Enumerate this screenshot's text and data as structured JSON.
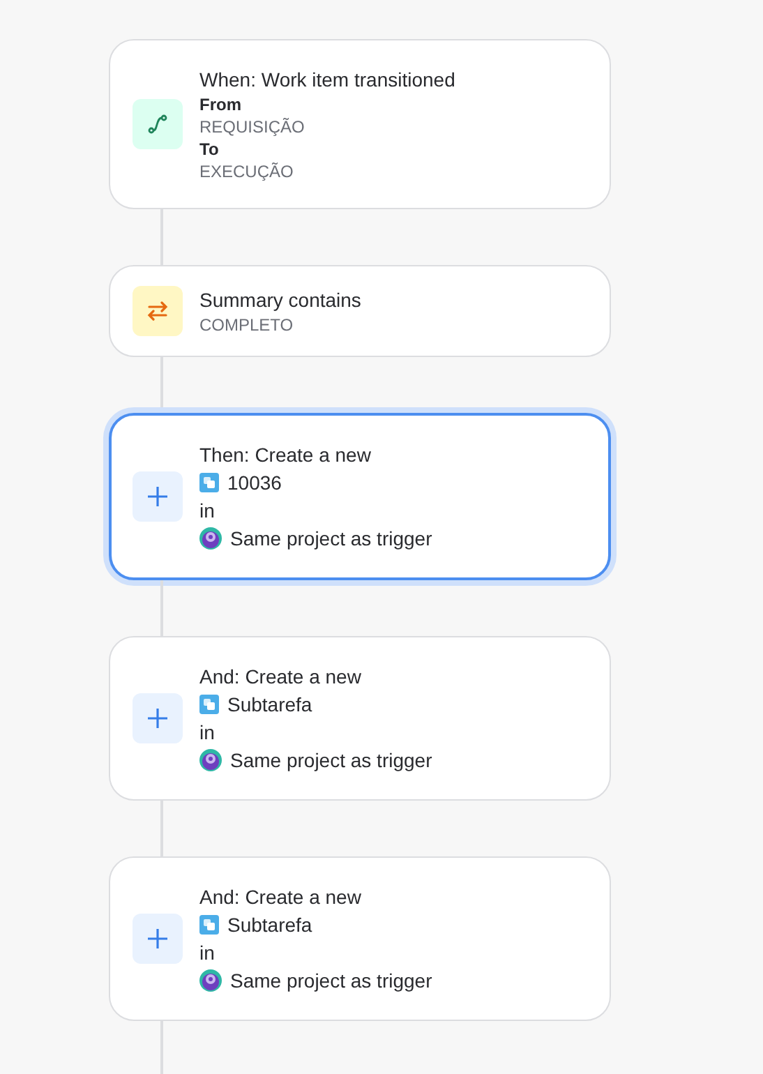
{
  "steps": [
    {
      "kind": "trigger",
      "selected": false,
      "title": "When: Work item transitioned",
      "details": [
        {
          "kind": "label",
          "text": "From"
        },
        {
          "kind": "value",
          "text": "REQUISIÇÃO"
        },
        {
          "kind": "label",
          "text": "To"
        },
        {
          "kind": "value",
          "text": "EXECUÇÃO"
        }
      ]
    },
    {
      "kind": "condition",
      "selected": false,
      "title": "Summary contains",
      "details": [
        {
          "kind": "value",
          "text": "COMPLETO"
        }
      ]
    },
    {
      "kind": "action",
      "selected": true,
      "title": "Then: Create a new",
      "details": [
        {
          "kind": "issue-type",
          "text": "10036"
        },
        {
          "kind": "text",
          "text": "in"
        },
        {
          "kind": "project",
          "text": "Same project as trigger"
        }
      ]
    },
    {
      "kind": "action",
      "selected": false,
      "title": "And: Create a new",
      "details": [
        {
          "kind": "issue-type",
          "text": "Subtarefa"
        },
        {
          "kind": "text",
          "text": "in"
        },
        {
          "kind": "project",
          "text": "Same project as trigger"
        }
      ]
    },
    {
      "kind": "action",
      "selected": false,
      "title": "And: Create a new",
      "details": [
        {
          "kind": "issue-type",
          "text": "Subtarefa"
        },
        {
          "kind": "text",
          "text": "in"
        },
        {
          "kind": "project",
          "text": "Same project as trigger"
        }
      ]
    }
  ]
}
